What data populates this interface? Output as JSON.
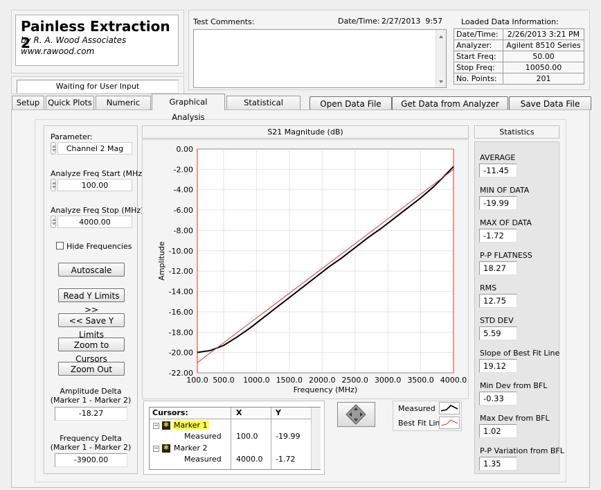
{
  "app": {
    "title": "Painless Extraction 2",
    "author": "by R. A. Wood Associates",
    "website": "www.rawood.com",
    "status": "Waiting for User Input"
  },
  "comments": {
    "label": "Test Comments:",
    "value": ""
  },
  "datetime": {
    "label": "Date/Time:",
    "value": "2/27/2013  9:57"
  },
  "loaded_info": {
    "title": "Loaded Data Information:",
    "rows": [
      {
        "label": "Date/Time:",
        "value": "2/26/2013 3:21 PM"
      },
      {
        "label": "Analyzer:",
        "value": "Agilent 8510 Series"
      },
      {
        "label": "Start Freq:",
        "value": "50.00"
      },
      {
        "label": "Stop Freq:",
        "value": "10050.00"
      },
      {
        "label": "No. Points:",
        "value": "201"
      }
    ]
  },
  "tabs": [
    "Setup",
    "Quick Plots",
    "Numeric Data",
    "Graphical Analysis",
    "Statistical Analysis"
  ],
  "actions": {
    "open": "Open Data File",
    "get": "Get Data from Analyzer",
    "save": "Save Data File"
  },
  "left": {
    "parameter_label": "Parameter:",
    "parameter_value": "Channel 2 Mag",
    "freq_start_label": "Analyze Freq Start (MHz)",
    "freq_start_value": "100.00",
    "freq_stop_label": "Analyze Freq Stop (MHz)",
    "freq_stop_value": "4000.00",
    "hide_freq_label": "Hide Frequencies",
    "hide_freq_checked": false,
    "autoscale": "Autoscale",
    "read_y": "Read Y Limits >>",
    "save_y": "<< Save Y Limits",
    "zoom_cursors": "Zoom to Cursors",
    "zoom_out": "Zoom Out",
    "amp_delta_label1": "Amplitude Delta",
    "amp_delta_label2": "(Marker 1 - Marker 2)",
    "amp_delta_value": "-18.27",
    "freq_delta_label1": "Frequency Delta",
    "freq_delta_label2": "(Marker 1 - Marker 2)",
    "freq_delta_value": "-3900.00"
  },
  "graph": {
    "title": "S21 Magnitude (dB)"
  },
  "chart_data": {
    "type": "line",
    "title": "S21 Magnitude (dB)",
    "xlabel": "Frequency (MHz)",
    "ylabel": "Amplitude",
    "xlim": [
      100,
      4000
    ],
    "ylim": [
      -22,
      0
    ],
    "x_ticks": [
      "100.0",
      "500.0",
      "1000.0",
      "1500.0",
      "2000.0",
      "2500.0",
      "3000.0",
      "3500.0",
      "4000.0"
    ],
    "y_ticks": [
      "0.00",
      "-2.00",
      "-4.00",
      "-6.00",
      "-8.00",
      "-10.00",
      "-12.00",
      "-14.00",
      "-16.00",
      "-18.00",
      "-20.00",
      "-22.00"
    ],
    "grid": true,
    "series": [
      {
        "name": "Measured",
        "color": "#000000",
        "x": [
          100,
          300,
          500,
          700,
          900,
          1100,
          1300,
          1500,
          1700,
          1900,
          2100,
          2300,
          2500,
          2700,
          2900,
          3100,
          3300,
          3500,
          3700,
          3900,
          4000
        ],
        "y": [
          -19.99,
          -19.8,
          -19.3,
          -18.5,
          -17.6,
          -16.6,
          -15.6,
          -14.6,
          -13.6,
          -12.6,
          -11.6,
          -10.7,
          -9.7,
          -8.7,
          -7.8,
          -6.8,
          -5.8,
          -4.8,
          -3.7,
          -2.4,
          -1.72
        ]
      },
      {
        "name": "Best Fit Line",
        "color": "#e03030",
        "x": [
          100,
          4000
        ],
        "y": [
          -21.0,
          -2.0
        ]
      }
    ],
    "cursors": [
      {
        "name": "Marker 1",
        "x": 100.0,
        "y": -19.99
      },
      {
        "name": "Marker 2",
        "x": 4000.0,
        "y": -1.72
      }
    ]
  },
  "cursor_table": {
    "header": [
      "Cursors:",
      "X",
      "Y"
    ],
    "rows": [
      {
        "name": "Marker 1",
        "sub": "Measured",
        "x": "100.0",
        "y": "-19.99",
        "highlight": true
      },
      {
        "name": "Marker 2",
        "sub": "Measured",
        "x": "4000.0",
        "y": "-1.72",
        "highlight": false
      }
    ]
  },
  "legend": {
    "measured": "Measured",
    "bestfit": "Best Fit Line"
  },
  "statistics": {
    "title": "Statistics",
    "items": [
      {
        "label": "AVERAGE",
        "value": "-11.45"
      },
      {
        "label": "MIN OF DATA",
        "value": "-19.99"
      },
      {
        "label": "MAX OF DATA",
        "value": "-1.72"
      },
      {
        "label": "P-P FLATNESS",
        "value": "18.27"
      },
      {
        "label": "RMS",
        "value": "12.75"
      },
      {
        "label": "STD DEV",
        "value": "5.59"
      },
      {
        "label": "Slope of Best Fit Line",
        "value": "19.12"
      },
      {
        "label": "Min Dev from BFL",
        "value": "-0.33"
      },
      {
        "label": "Max Dev from BFL",
        "value": "1.02"
      },
      {
        "label": "P-P Variation from BFL",
        "value": "1.35"
      }
    ]
  }
}
